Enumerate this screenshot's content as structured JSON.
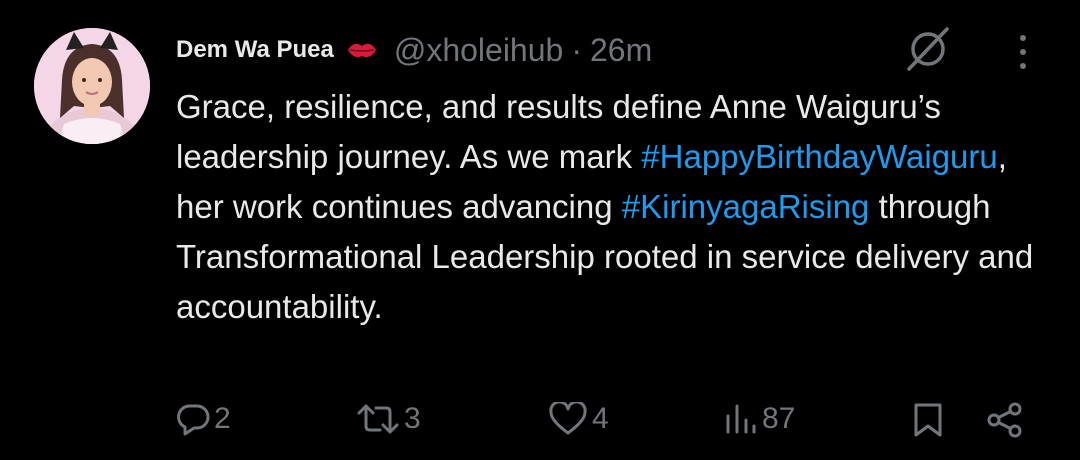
{
  "post": {
    "author_name": "Dem Wa Puea",
    "author_emoji": "kiss-mark-icon",
    "handle": "@xholeihub",
    "separator": "·",
    "time": "26m",
    "text_parts": [
      "Grace, resilience, and results define Anne Waiguru’s leadership journey. As we mark ",
      "#HappyBirthdayWaiguru",
      ", her work continues advancing ",
      "#KirinyagaRising",
      " through Transformational Leadership rooted in service delivery and accountability."
    ]
  },
  "actions": {
    "replies": "2",
    "reposts": "3",
    "likes": "4",
    "views": "87"
  },
  "colors": {
    "background": "#000000",
    "text": "#e7e9ea",
    "muted": "#71767b",
    "hashtag": "#1d9bf0"
  },
  "icons": [
    "reply-icon",
    "repost-icon",
    "like-icon",
    "views-icon",
    "bookmark-icon",
    "share-icon",
    "grok-icon",
    "more-icon"
  ]
}
